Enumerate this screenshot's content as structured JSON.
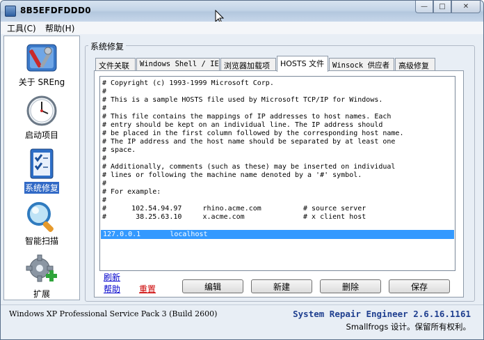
{
  "window": {
    "title": "8B5EFDFDDD0",
    "buttons": {
      "minimize": "—",
      "maximize": "□",
      "close": "✕"
    }
  },
  "menu": [
    {
      "label": "工具(C)"
    },
    {
      "label": "帮助(H)"
    }
  ],
  "sidebar": {
    "items": [
      {
        "label": "关于 SREng",
        "icon": "tools-icon"
      },
      {
        "label": "启动项目",
        "icon": "clock-icon"
      },
      {
        "label": "系统修复",
        "icon": "checklist-icon",
        "active": true
      },
      {
        "label": "智能扫描",
        "icon": "magnifier-icon"
      },
      {
        "label": "扩展",
        "icon": "gear-plus-icon"
      }
    ]
  },
  "group": {
    "label": "系统修复"
  },
  "tabs": [
    {
      "label": "文件关联"
    },
    {
      "label": "Windows Shell / IE"
    },
    {
      "label": "浏览器加载项"
    },
    {
      "label": "HOSTS 文件",
      "active": true
    },
    {
      "label": "Winsock 供应者"
    },
    {
      "label": "高级修复"
    }
  ],
  "hosts": {
    "lines": [
      "# Copyright (c) 1993-1999 Microsoft Corp.",
      "#",
      "# This is a sample HOSTS file used by Microsoft TCP/IP for Windows.",
      "#",
      "# This file contains the mappings of IP addresses to host names. Each",
      "# entry should be kept on an individual line. The IP address should",
      "# be placed in the first column followed by the corresponding host name.",
      "# The IP address and the host name should be separated by at least one",
      "# space.",
      "#",
      "# Additionally, comments (such as these) may be inserted on individual",
      "# lines or following the machine name denoted by a '#' symbol.",
      "#",
      "# For example:",
      "#",
      "#      102.54.94.97     rhino.acme.com          # source server",
      "#       38.25.63.10     x.acme.com              # x client host"
    ],
    "selected_line": "127.0.0.1       localhost"
  },
  "links": {
    "refresh": "刷新",
    "help": "帮助",
    "reset": "重置"
  },
  "buttons": {
    "edit": "编辑",
    "new": "新建",
    "delete": "删除",
    "save": "保存"
  },
  "status": {
    "os_info": "Windows XP Professional Service Pack 3 (Build 2600)",
    "product": "System Repair Engineer 2.6.16.1161",
    "copyright": "Smallfrogs 设计。保留所有权利。"
  },
  "colors": {
    "selection": "#3399ff",
    "link": "#0000cc",
    "reset_link": "#cc0000",
    "product": "#1f3f8f"
  }
}
